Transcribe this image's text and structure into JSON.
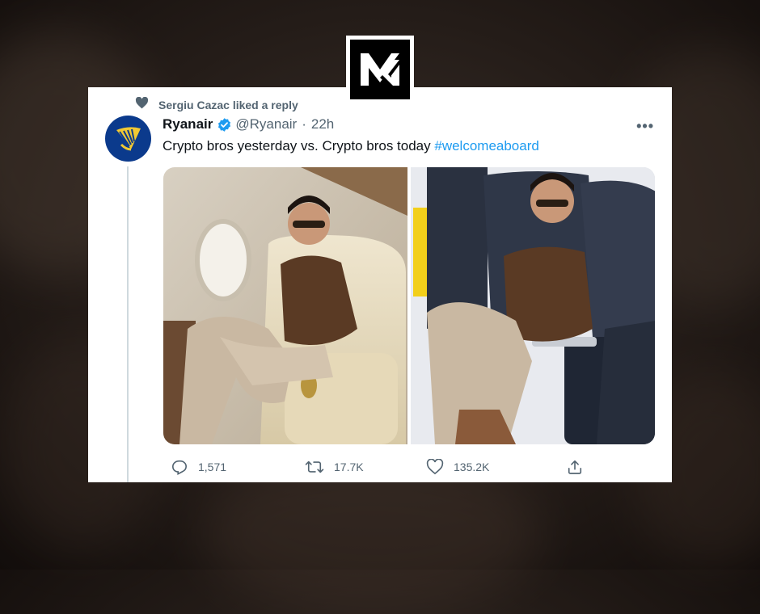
{
  "liked_by": "Sergiu Cazac liked a reply",
  "tweet": {
    "name": "Ryanair",
    "handle": "@Ryanair",
    "separator": "·",
    "time": "22h",
    "text_main": "Crypto bros yesterday vs. Crypto bros today ",
    "hashtag": "#welcomeaboard",
    "more_icon": "more-icon"
  },
  "stats": {
    "replies": "1,571",
    "retweets": "17.7K",
    "likes": "135.2K"
  },
  "colors": {
    "hashtag": "#1d9bf0",
    "verified": "#1d9bf0",
    "secondary_text": "#536471",
    "primary_text": "#0f1419",
    "avatar_bg": "#0b3a8c",
    "avatar_harp": "#f1c933"
  },
  "icons": {
    "liked": "heart-filled-icon",
    "verified": "verified-badge-icon",
    "reply": "reply-icon",
    "retweet": "retweet-icon",
    "like": "heart-outline-icon",
    "share": "share-icon",
    "logo": "m-logo-icon",
    "avatar": "ryanair-harp-icon"
  }
}
